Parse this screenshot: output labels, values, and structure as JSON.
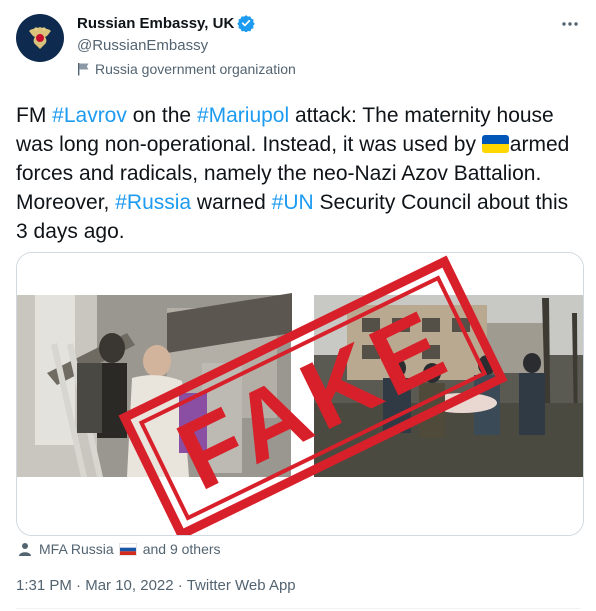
{
  "header": {
    "display_name": "Russian Embassy, UK",
    "handle": "@RussianEmbassy",
    "org_label": "Russia government organization"
  },
  "tweet": {
    "segments": [
      {
        "text": "FM ",
        "hashtag": false
      },
      {
        "text": "#Lavrov",
        "hashtag": true
      },
      {
        "text": " on the ",
        "hashtag": false
      },
      {
        "text": "#Mariupol",
        "hashtag": true
      },
      {
        "text": " attack: The maternity house was long non-operational. Instead, it was used by ",
        "hashtag": false
      },
      {
        "flag": "ukraine-flag"
      },
      {
        "text": "armed forces and radicals, namely the neo-Nazi Azov Battalion. Moreover, ",
        "hashtag": false
      },
      {
        "text": "#Russia",
        "hashtag": true
      },
      {
        "text": " warned ",
        "hashtag": false
      },
      {
        "text": "#UN",
        "hashtag": true
      },
      {
        "text": " Security Council about this 3 days ago.",
        "hashtag": false
      }
    ],
    "media_stamp": "FAKE"
  },
  "likes": {
    "first_name": "MFA Russia",
    "others": "and 9 others"
  },
  "meta": {
    "time": "1:31 PM",
    "separator": "·",
    "date": "Mar 10, 2022",
    "client": "Twitter Web App"
  },
  "colors": {
    "accent": "#1d9bf0",
    "text": "#0f1419",
    "secondary": "#536471",
    "stamp_red": "#d8202a"
  },
  "icons": {
    "verified": "verified-badge-icon",
    "more": "more-options-icon",
    "org": "government-flag-icon",
    "likes": "person-icon"
  }
}
